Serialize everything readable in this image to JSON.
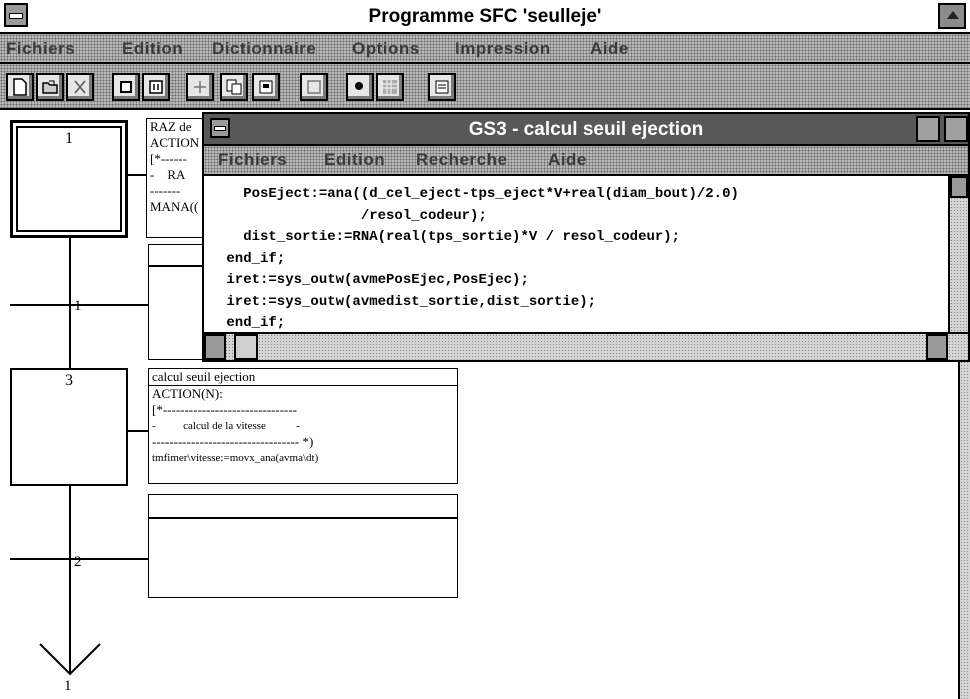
{
  "window": {
    "title": "Programme SFC 'seulleje'",
    "menu": [
      "Fichiers",
      "Edition",
      "Dictionnaire",
      "Options",
      "Impression",
      "Aide"
    ]
  },
  "toolbar": {
    "buttons": [
      "new-icon",
      "open-icon",
      "cut-icon",
      "step-icon",
      "transition-icon",
      "grid-icon",
      "copy-icon",
      "paste-icon",
      "zoom-icon",
      "run-icon",
      "monitor-icon",
      "print-icon"
    ]
  },
  "sfc": {
    "steps": [
      {
        "num": "1",
        "action_lines": [
          "RAZ de",
          "ACTION",
          "[*------",
          "-    RA",
          "-------",
          "MANA(("
        ]
      },
      {
        "num": "3",
        "action_lines": [
          "calcul seuil ejection",
          "ACTION(N):",
          "[*-------------------------------",
          "-          calcul de la vitesse           -",
          "---------------------------------- *)",
          "tmfimer\\vitesse:=movx_ana(avma\\dt)"
        ]
      }
    ],
    "transitions": [
      "1",
      "2"
    ],
    "end_label": "1"
  },
  "gs3": {
    "title": "GS3 - calcul seuil ejection",
    "menu": [
      "Fichiers",
      "Edition",
      "Recherche",
      "Aide"
    ],
    "code_lines": [
      "   PosEject:=ana((d_cel_eject-tps_eject*V+real(diam_bout)/2.0)",
      "                 /resol_codeur);",
      "   dist_sortie:=RNA(real(tps_sortie)*V / resol_codeur);",
      " end_if;",
      " iret:=sys_outw(avmePosEjec,PosEjec);",
      " iret:=sys_outw(avmedist_sortie,dist_sortie);",
      " end_if;"
    ]
  }
}
